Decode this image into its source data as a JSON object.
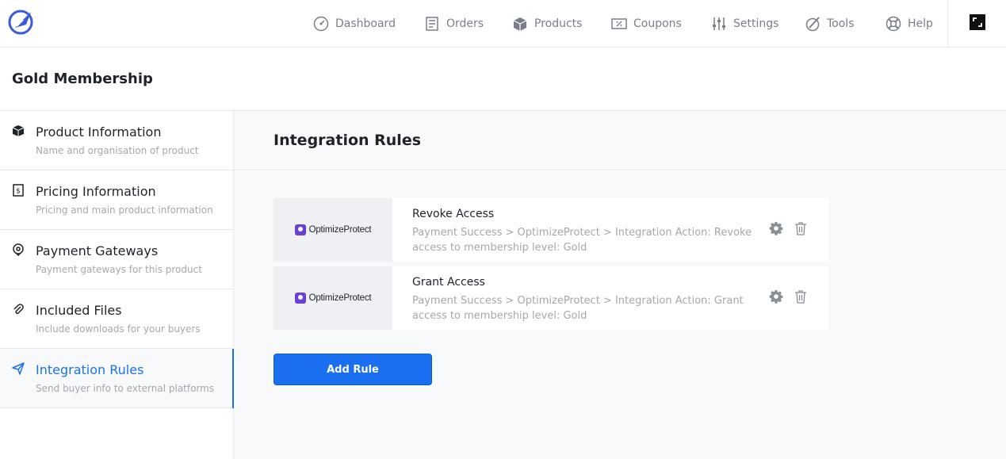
{
  "header": {
    "nav": [
      {
        "label": "Dashboard",
        "icon": "dashboard-gauge-icon"
      },
      {
        "label": "Orders",
        "icon": "receipt-icon"
      },
      {
        "label": "Products",
        "icon": "box-icon"
      },
      {
        "label": "Coupons",
        "icon": "ticket-icon"
      },
      {
        "label": "Settings",
        "icon": "sliders-icon"
      },
      {
        "label": "Tools",
        "icon": "tools-icon"
      },
      {
        "label": "Help",
        "icon": "lifebuoy-icon"
      }
    ],
    "expand_icon": "expand-icon",
    "logo_icon": "rocket-logo-icon"
  },
  "page": {
    "title": "Gold Membership"
  },
  "sidebar": {
    "items": [
      {
        "label": "Product Information",
        "desc": "Name and organisation of product",
        "icon": "box-icon"
      },
      {
        "label": "Pricing Information",
        "desc": "Pricing and main product information",
        "icon": "price-tag-icon"
      },
      {
        "label": "Payment Gateways",
        "desc": "Payment gateways for this product",
        "icon": "location-pin-icon"
      },
      {
        "label": "Included Files",
        "desc": "Include downloads for your buyers",
        "icon": "paperclip-icon"
      },
      {
        "label": "Integration Rules",
        "desc": "Send buyer info to external platforms",
        "icon": "send-icon"
      }
    ],
    "active_index": 4
  },
  "main": {
    "section_title": "Integration Rules",
    "rules": [
      {
        "integration": "OptimizeProtect",
        "title": "Revoke Access",
        "description": "Payment Success > OptimizeProtect > Integration Action: Revoke access to membership level: Gold"
      },
      {
        "integration": "OptimizeProtect",
        "title": "Grant Access",
        "description": "Payment Success > OptimizeProtect > Integration Action: Grant access to membership level: Gold"
      }
    ],
    "add_button": "Add Rule"
  },
  "colors": {
    "accent": "#1a6ff0",
    "active_text": "#1a73e8",
    "logo": "#3b5bdb",
    "brand_mark": "#6b3fd6"
  }
}
